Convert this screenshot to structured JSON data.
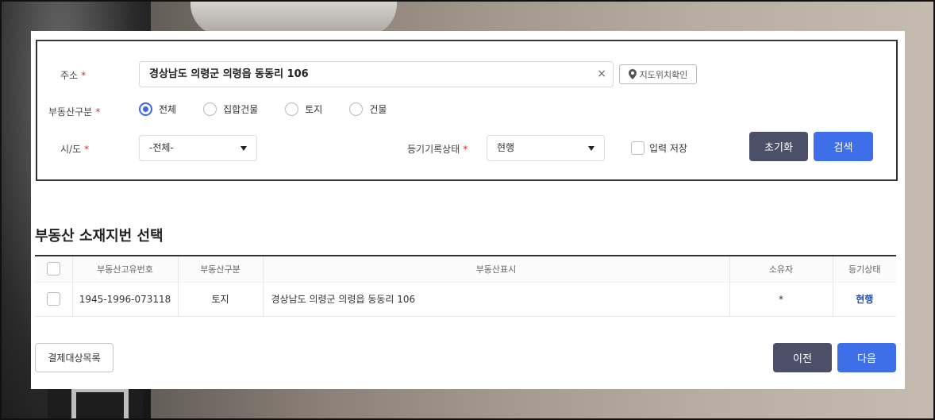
{
  "search": {
    "address_label": "주소",
    "required_mark": "*",
    "address_value": "경상남도 의령군 의령읍 동동리 106",
    "clear_icon": "×",
    "map_button": "지도위치확인",
    "property_type_label": "부동산구분",
    "property_types": [
      "전체",
      "집합건물",
      "토지",
      "건물"
    ],
    "selected_property_type": "전체",
    "sido_label": "시/도",
    "sido_value": "-전체-",
    "register_status_label": "등기기록상태",
    "register_status_value": "현행",
    "save_input_label": "입력 저장",
    "reset_button": "초기화",
    "search_button": "검색"
  },
  "section": {
    "title": "부동산 소재지번 선택"
  },
  "table": {
    "headers": [
      "부동산고유번호",
      "부동산구분",
      "부동산표시",
      "소유자",
      "등기상태"
    ],
    "rows": [
      {
        "id": "1945-1996-073118",
        "type": "토지",
        "address": "경상남도 의령군 의령읍 동동리 106",
        "owner": "*",
        "status": "현행"
      }
    ]
  },
  "footer": {
    "payment_list_button": "결제대상목록",
    "prev_button": "이전",
    "next_button": "다음"
  },
  "colors": {
    "accent": "#3e6ee8",
    "dark_button": "#4b5068",
    "required": "#e0262b",
    "status_link": "#2b4f9e"
  }
}
